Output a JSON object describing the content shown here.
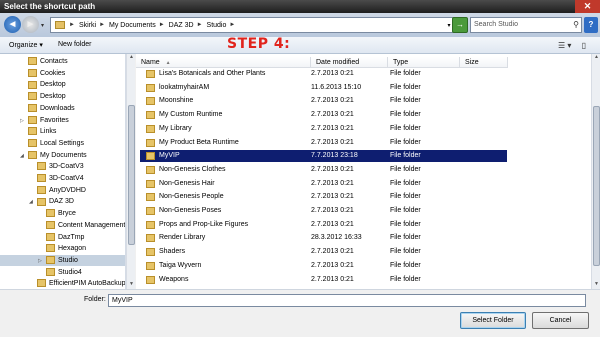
{
  "window": {
    "title": "Select the shortcut path",
    "close_glyph": "✕"
  },
  "address": {
    "back_glyph": "◄",
    "forward_glyph": "►",
    "recent_glyph": "▾",
    "breadcrumbs": [
      "Skirki",
      "My Documents",
      "DAZ 3D",
      "Studio"
    ],
    "separator": "►",
    "dropdown_glyph": "▾",
    "refresh_glyph": "→",
    "search_placeholder": "Search Studio",
    "search_glyph": "⚲",
    "help_glyph": "?"
  },
  "toolbar": {
    "organize": "Organize ▾",
    "new_folder": "New folder",
    "step_banner": "STEP 4:",
    "view_glyph": "☰ ▾",
    "layout_glyph": "▯"
  },
  "nav": {
    "items": [
      {
        "label": "Contacts",
        "twist": "",
        "indent": 1
      },
      {
        "label": "Cookies",
        "twist": "",
        "indent": 1
      },
      {
        "label": "Desktop",
        "twist": "",
        "indent": 1
      },
      {
        "label": "Desktop",
        "twist": "",
        "indent": 1
      },
      {
        "label": "Downloads",
        "twist": "",
        "indent": 1
      },
      {
        "label": "Favorites",
        "twist": "▷",
        "indent": 1
      },
      {
        "label": "Links",
        "twist": "",
        "indent": 1
      },
      {
        "label": "Local Settings",
        "twist": "",
        "indent": 1
      },
      {
        "label": "My Documents",
        "twist": "◢",
        "indent": 1
      },
      {
        "label": "3D-CoatV3",
        "twist": "",
        "indent": 2
      },
      {
        "label": "3D-CoatV4",
        "twist": "",
        "indent": 2
      },
      {
        "label": "AnyDVDHD",
        "twist": "",
        "indent": 2
      },
      {
        "label": "DAZ 3D",
        "twist": "◢",
        "indent": 2
      },
      {
        "label": "Bryce",
        "twist": "",
        "indent": 3
      },
      {
        "label": "Content Management Se",
        "twist": "",
        "indent": 3
      },
      {
        "label": "DazTmp",
        "twist": "",
        "indent": 3
      },
      {
        "label": "Hexagon",
        "twist": "",
        "indent": 3
      },
      {
        "label": "Studio",
        "twist": "▷",
        "indent": 3
      },
      {
        "label": "Studio4",
        "twist": "",
        "indent": 3
      },
      {
        "label": "EfficientPIM AutoBackup",
        "twist": "",
        "indent": 2
      }
    ],
    "selected_index": 17
  },
  "files": {
    "columns": {
      "name": "Name",
      "date": "Date modified",
      "type": "Type",
      "size": "Size",
      "sort_glyph": "▲"
    },
    "rows": [
      {
        "name": "Lisa's Botanicals and Other Plants",
        "date": "2.7.2013 0:21",
        "type": "File folder"
      },
      {
        "name": "lookatmyhairAM",
        "date": "11.6.2013 15:10",
        "type": "File folder"
      },
      {
        "name": "Moonshine",
        "date": "2.7.2013 0:21",
        "type": "File folder"
      },
      {
        "name": "My Custom Runtime",
        "date": "2.7.2013 0:21",
        "type": "File folder"
      },
      {
        "name": "My Library",
        "date": "2.7.2013 0:21",
        "type": "File folder"
      },
      {
        "name": "My Product Beta Runtime",
        "date": "2.7.2013 0:21",
        "type": "File folder"
      },
      {
        "name": "MyVIP",
        "date": "7.7.2013 23:18",
        "type": "File folder"
      },
      {
        "name": "Non-Genesis Clothes",
        "date": "2.7.2013 0:21",
        "type": "File folder"
      },
      {
        "name": "Non-Genesis Hair",
        "date": "2.7.2013 0:21",
        "type": "File folder"
      },
      {
        "name": "Non-Genesis People",
        "date": "2.7.2013 0:21",
        "type": "File folder"
      },
      {
        "name": "Non-Genesis Poses",
        "date": "2.7.2013 0:21",
        "type": "File folder"
      },
      {
        "name": "Props and Prop-Like Figures",
        "date": "2.7.2013 0:21",
        "type": "File folder"
      },
      {
        "name": "Render Library",
        "date": "28.3.2012 16:33",
        "type": "File folder"
      },
      {
        "name": "Shaders",
        "date": "2.7.2013 0:21",
        "type": "File folder"
      },
      {
        "name": "Taiga Wyvern",
        "date": "2.7.2013 0:21",
        "type": "File folder"
      },
      {
        "name": "Weapons",
        "date": "2.7.2013 0:21",
        "type": "File folder"
      }
    ],
    "selected_index": 6
  },
  "scroll": {
    "up_glyph": "▲",
    "down_glyph": "▼",
    "nav_position": 0.55,
    "files_position": 0.75
  },
  "footer": {
    "folder_label": "Folder:",
    "folder_value": "MyVIP",
    "select_button": "Select Folder",
    "cancel_button": "Cancel"
  }
}
